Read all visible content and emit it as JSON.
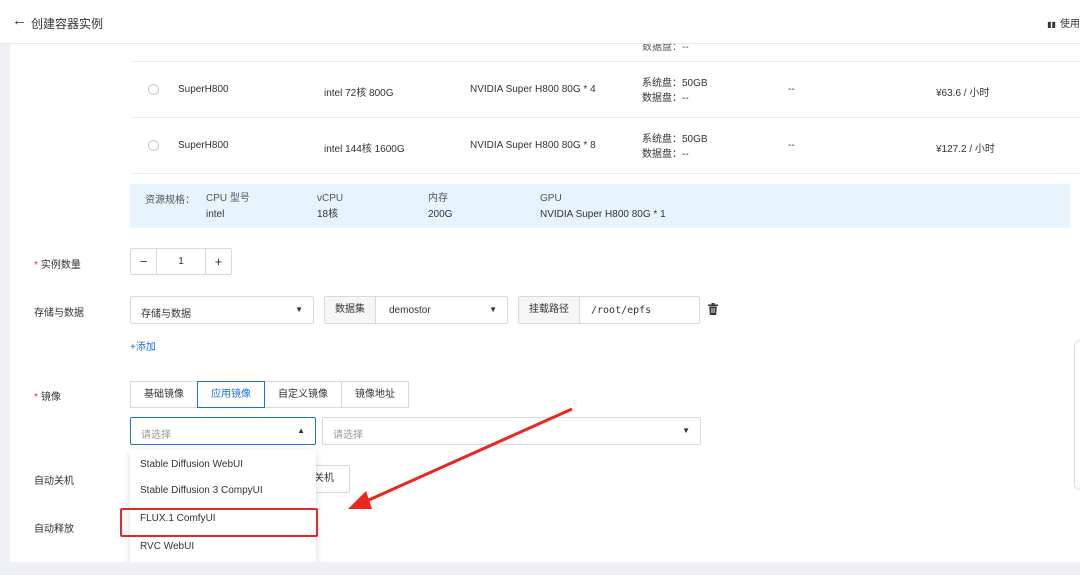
{
  "header": {
    "back_icon": "arrow-left-icon",
    "title": "创建容器实例",
    "doc_link": "使用"
  },
  "gpu_table": {
    "partial_row_text": "数据盘：--",
    "rows": [
      {
        "name": "SuperH800",
        "cpu": "intel 72核 800G",
        "gpu": "NVIDIA Super H800 80G * 4",
        "system_disk": "系统盘：50GB",
        "data_disk": "数据盘：--",
        "extra": "--",
        "price": "¥63.6 / 小时"
      },
      {
        "name": "SuperH800",
        "cpu": "intel 144核 1600G",
        "gpu": "NVIDIA Super H800 80G * 8",
        "system_disk": "系统盘：50GB",
        "data_disk": "数据盘：--",
        "extra": "--",
        "price": "¥127.2 / 小时"
      }
    ]
  },
  "spec": {
    "label": "资源规格：",
    "cpu_model": {
      "header": "CPU 型号",
      "value": "intel"
    },
    "vcpu": {
      "header": "vCPU",
      "value": "18核"
    },
    "memory": {
      "header": "内存",
      "value": "200G"
    },
    "gpu": {
      "header": "GPU",
      "value": "NVIDIA Super H800 80G * 1"
    }
  },
  "instance_count": {
    "label": "实例数量",
    "required_mark": "*",
    "minus": "−",
    "value": "1",
    "plus": "+"
  },
  "storage": {
    "label": "存储与数据",
    "type_select": "存储与数据",
    "dataset_addon": "数据集",
    "dataset_value": "demostor",
    "mount_addon": "挂载路径",
    "mount_value": "/root/epfs",
    "add_link": "+添加"
  },
  "image": {
    "label": "镜像",
    "required_mark": "*",
    "tabs": [
      "基础镜像",
      "应用镜像",
      "自定义镜像",
      "镜像地址"
    ],
    "active_tab": 1,
    "select_placeholder": "请选择",
    "version_placeholder": "请选择",
    "dropdown_options": [
      "Stable Diffusion WebUI",
      "Stable Diffusion 3 CompyUI",
      "FLUX.1 ComfyUI",
      "RVC WebUI"
    ],
    "highlighted_option": "FLUX.1 ComfyUI"
  },
  "auto_shutdown": {
    "label": "自动关机",
    "button_partial": "关机"
  },
  "auto_release": {
    "label": "自动释放"
  },
  "colors": {
    "accent": "#1e6fe0",
    "required": "#f5222d",
    "annotation": "#e8271f",
    "spec_bg": "#e7f3fd"
  }
}
